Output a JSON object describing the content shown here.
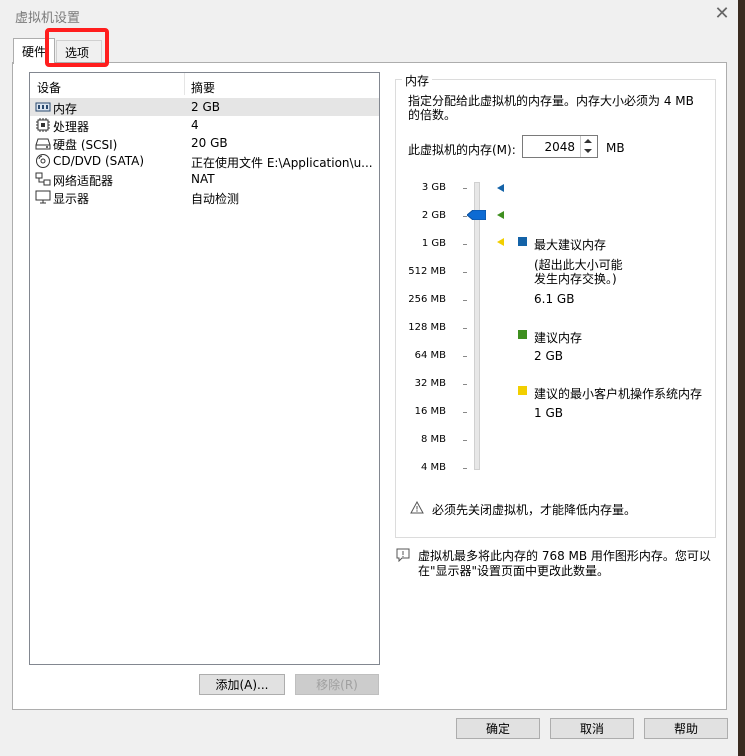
{
  "window": {
    "title": "虚拟机设置",
    "close_label": "✕"
  },
  "tabs": [
    {
      "label": "硬件"
    },
    {
      "label": "选项"
    }
  ],
  "devices": {
    "headers": {
      "device": "设备",
      "summary": "摘要"
    },
    "rows": [
      {
        "name": "内存",
        "summary": "2 GB",
        "icon": "memory-icon",
        "selected": true
      },
      {
        "name": "处理器",
        "summary": "4",
        "icon": "processor-icon"
      },
      {
        "name": "硬盘 (SCSI)",
        "summary": "20 GB",
        "icon": "hard-disk-icon"
      },
      {
        "name": "CD/DVD (SATA)",
        "summary": "正在使用文件 E:\\Application\\u...",
        "icon": "cd-dvd-icon"
      },
      {
        "name": "网络适配器",
        "summary": "NAT",
        "icon": "network-adapter-icon"
      },
      {
        "name": "显示器",
        "summary": "自动检测",
        "icon": "display-icon"
      }
    ]
  },
  "list_buttons": {
    "add": "添加(A)...",
    "remove": "移除(R)"
  },
  "memory": {
    "group_title": "内存",
    "description": "指定分配给此虚拟机的内存量。内存大小必须为 4 MB 的倍数。",
    "field_label": "此虚拟机的内存(M):",
    "value": "2048",
    "unit": "MB",
    "scale_labels": [
      "3 GB",
      "2 GB",
      "1 GB",
      "512 MB",
      "256 MB",
      "128 MB",
      "64 MB",
      "32 MB",
      "16 MB",
      "8 MB",
      "4 MB"
    ],
    "slider_value": "2 GB",
    "legend": {
      "max": {
        "title": "最大建议内存",
        "note": "(超出此大小可能发生内存交换。)",
        "value": "6.1 GB",
        "color": "#1463a8"
      },
      "recommended": {
        "title": "建议内存",
        "value": "2 GB",
        "color": "#3e8f1f"
      },
      "min": {
        "title": "建议的最小客户机操作系统内存",
        "value": "1 GB",
        "color": "#f2cf00"
      }
    },
    "warning": "必须先关闭虚拟机，才能降低内存量。",
    "graphics_note": "虚拟机最多将此内存的 768 MB 用作图形内存。您可以在\"显示器\"设置页面中更改此数量。"
  },
  "footer_buttons": {
    "ok": "确定",
    "cancel": "取消",
    "help": "帮助"
  }
}
